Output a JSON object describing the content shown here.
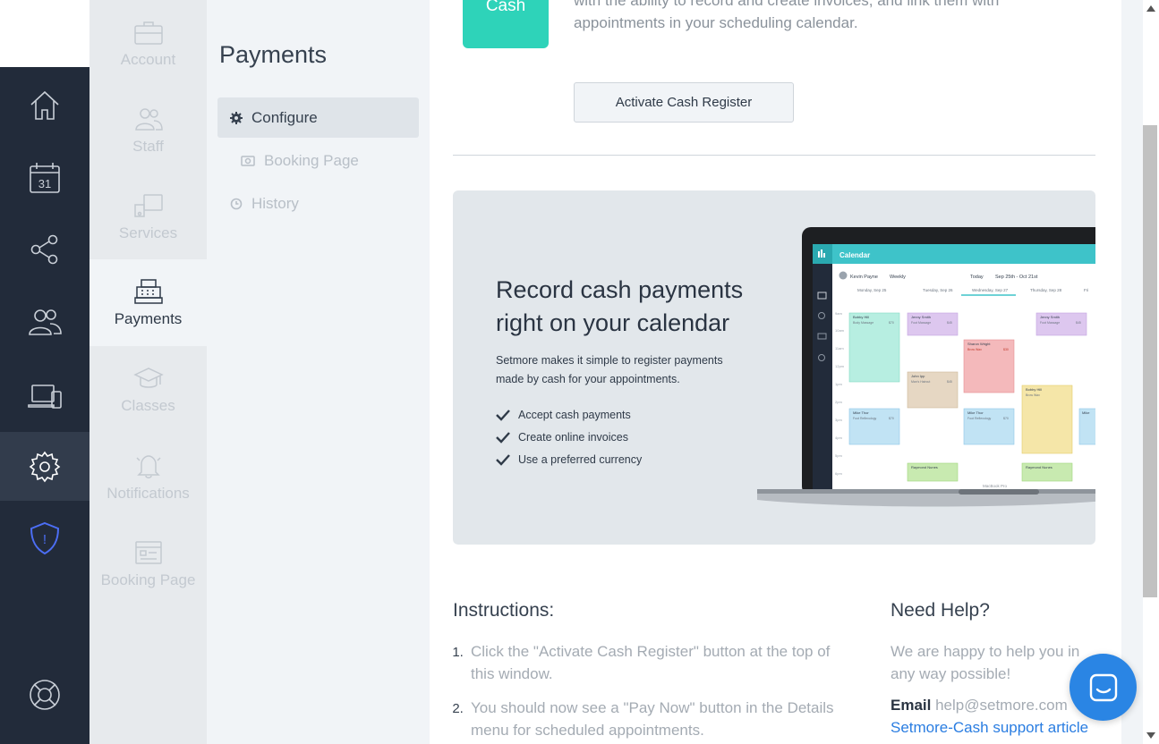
{
  "colors": {
    "rail_bg": "#222b3a",
    "accent_teal": "#2ed3b9",
    "link_blue": "#2a7de1",
    "chat_blue": "#2a85e4"
  },
  "rail": {
    "items": [
      {
        "icon": "home-icon"
      },
      {
        "icon": "calendar-icon",
        "label": "31"
      },
      {
        "icon": "share-icon"
      },
      {
        "icon": "customers-icon"
      },
      {
        "icon": "devices-icon"
      },
      {
        "icon": "settings-icon"
      },
      {
        "icon": "shield-alert-icon",
        "label": "!"
      },
      {
        "icon": "help-lifebuoy-icon"
      }
    ]
  },
  "categories": {
    "items": [
      {
        "label": "Account",
        "icon": "briefcase-icon"
      },
      {
        "label": "Staff",
        "icon": "staff-icon"
      },
      {
        "label": "Services",
        "icon": "services-icon"
      },
      {
        "label": "Payments",
        "icon": "cash-register-icon"
      },
      {
        "label": "Classes",
        "icon": "graduation-cap-icon"
      },
      {
        "label": "Notifications",
        "icon": "bell-icon"
      },
      {
        "label": "Booking Page",
        "icon": "booking-page-icon"
      }
    ]
  },
  "submenu": {
    "title": "Payments",
    "items": [
      {
        "label": "Configure",
        "icon": "gear-icon"
      },
      {
        "label": "Booking Page",
        "icon": "cash-icon"
      },
      {
        "label": "History",
        "icon": "clock-icon"
      }
    ]
  },
  "main": {
    "badge": "Cash",
    "intro": "with the ability to record and create invoices, and link them with appointments in your scheduling calendar.",
    "activate_button": "Activate Cash Register",
    "promo": {
      "title": "Record cash payments right on your calendar",
      "description": "Setmore makes it simple to register payments made by cash for your appointments.",
      "features": [
        "Accept cash payments",
        "Create online invoices",
        "Use a preferred currency"
      ],
      "screen": {
        "app_title": "Calendar",
        "staff": "Kevin Payne",
        "view": "Weekly",
        "today": "Today",
        "range": "Sep 25th - Oct 21st",
        "days": [
          "Monday, Sep 25",
          "Tuesday, Sep 26",
          "Wednesday, Sep 27",
          "Thursday, Sep 28",
          "Fri"
        ],
        "times": [
          "9am",
          "10am",
          "11am",
          "12pm",
          "1pm",
          "2pm",
          "3pm",
          "4pm",
          "5pm",
          "6pm"
        ],
        "appointments": [
          {
            "name": "Bobby Hill",
            "service": "Body Massage",
            "price": "$70"
          },
          {
            "name": "Jenny Smith",
            "service": "Foot Massage",
            "price": "$45"
          },
          {
            "name": "Jenny Smith",
            "service": "Foot Massage",
            "price": "$45"
          },
          {
            "name": "Sharon Wright",
            "service": "Brow Wax",
            "price": "$30"
          },
          {
            "name": "John Ipp",
            "service": "Man's Haircut",
            "price": "$45"
          },
          {
            "name": "Bobby Hill",
            "service": "Brow Wax",
            "price": ""
          },
          {
            "name": "Mike Thor",
            "service": "Foot Reflexology",
            "price": "$70"
          },
          {
            "name": "Mike Thor",
            "service": "Foot Reflexology",
            "price": "$70"
          },
          {
            "name": "Mike",
            "service": "",
            "price": ""
          },
          {
            "name": "Raymond Nunes",
            "service": "",
            "price": ""
          },
          {
            "name": "Raymond Nunes",
            "service": "",
            "price": ""
          }
        ],
        "device_label": "MacBook Pro"
      }
    },
    "instructions": {
      "title": "Instructions:",
      "steps": [
        "Click the \"Activate Cash Register\" button at the top of this window.",
        "You should now see a \"Pay Now\" button in the Details menu for scheduled appointments."
      ]
    },
    "help": {
      "title": "Need Help?",
      "text": "We are happy to help you in any way possible!",
      "email_label": "Email",
      "email": "help@setmore.com",
      "link": "Setmore-Cash support article"
    }
  },
  "chat": {
    "icon": "chat-icon"
  }
}
